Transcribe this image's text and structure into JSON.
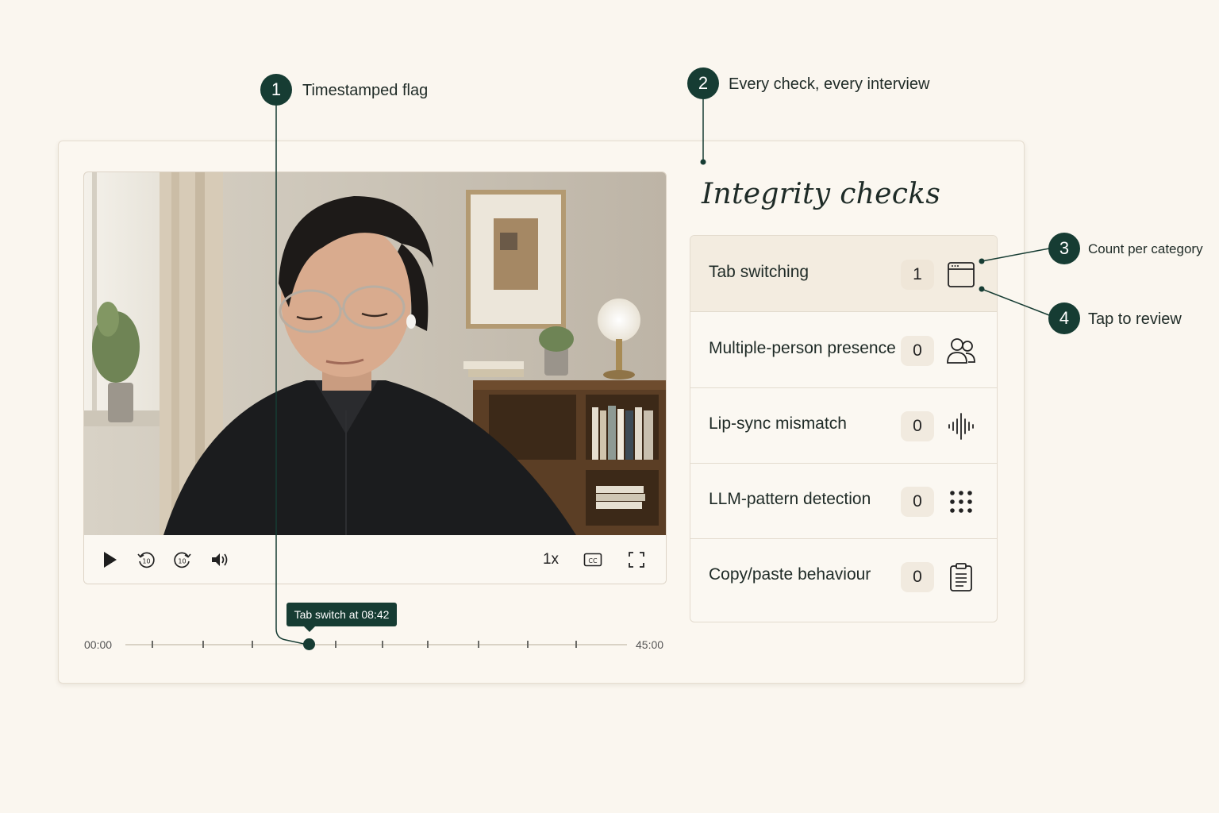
{
  "callouts": [
    {
      "number": "1",
      "label": "Timestamped flag"
    },
    {
      "number": "2",
      "label": "Every check, every interview"
    },
    {
      "number": "3",
      "label": "Count per category"
    },
    {
      "number": "4",
      "label": "Tap to review"
    }
  ],
  "player": {
    "speed": "1x",
    "icons": [
      "play-icon",
      "rewind-10-icon",
      "forward-10-icon",
      "volume-icon",
      "captions-icon",
      "fullscreen-icon"
    ]
  },
  "timeline": {
    "start": "00:00",
    "end": "45:00",
    "flag_tooltip": "Tab switch at 08:42",
    "flag_progress": 0.193
  },
  "checks": {
    "title": "Integrity checks",
    "items": [
      {
        "label": "Tab switching",
        "count": "1",
        "icon": "browser-window-icon"
      },
      {
        "label": "Multiple-person presence",
        "count": "0",
        "icon": "people-icon"
      },
      {
        "label": "Lip-sync mismatch",
        "count": "0",
        "icon": "audio-waveform-icon"
      },
      {
        "label": "LLM-pattern detection",
        "count": "0",
        "icon": "dot-grid-icon"
      },
      {
        "label": "Copy/paste behaviour",
        "count": "0",
        "icon": "clipboard-icon"
      }
    ]
  },
  "colors": {
    "accent": "#163c33",
    "background": "#faf6ef"
  }
}
